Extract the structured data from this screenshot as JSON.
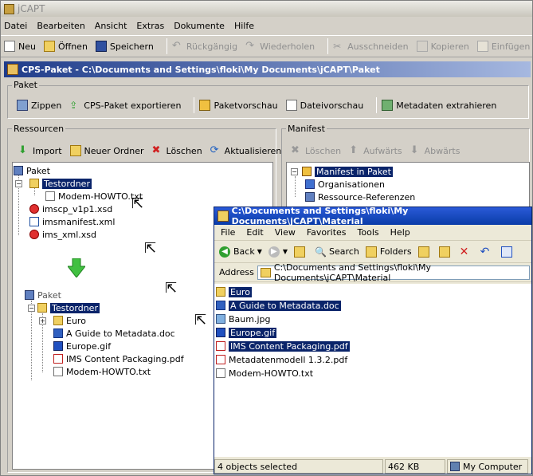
{
  "app": {
    "title": "jCAPT"
  },
  "menu": [
    "Datei",
    "Bearbeiten",
    "Ansicht",
    "Extras",
    "Dokumente",
    "Hilfe"
  ],
  "toolbar": {
    "neu": "Neu",
    "oeffnen": "Öffnen",
    "speichern": "Speichern",
    "rueckgaengig": "Rückgängig",
    "wiederholen": "Wiederholen",
    "ausschneiden": "Ausschneiden",
    "kopieren": "Kopieren",
    "einfuegen": "Einfügen"
  },
  "path": "CPS-Paket - C:\\Documents and Settings\\floki\\My Documents\\jCAPT\\Paket",
  "paket": {
    "label": "Paket",
    "buttons": [
      "Zippen",
      "CPS-Paket exportieren",
      "Paketvorschau",
      "Dateivorschau",
      "Metadaten extrahieren"
    ]
  },
  "ressourcen": {
    "label": "Ressourcen",
    "buttons": [
      "Import",
      "Neuer Ordner",
      "Löschen",
      "Aktualisieren"
    ],
    "tree_top": {
      "root": "Paket",
      "folder": "Testordner",
      "child": "Modem-HOWTO.txt",
      "files": [
        "imscp_v1p1.xsd",
        "imsmanifest.xml",
        "ims_xml.xsd"
      ]
    },
    "tree_bottom": {
      "root": "Paket",
      "folder": "Testordner",
      "children": [
        "Euro",
        "A Guide to Metadata.doc",
        "Europe.gif",
        "IMS Content Packaging.pdf",
        "Modem-HOWTO.txt"
      ]
    }
  },
  "manifest": {
    "label": "Manifest",
    "buttons": [
      "Löschen",
      "Aufwärts",
      "Abwärts"
    ],
    "tree": {
      "root": "Manifest in Paket",
      "children": [
        "Organisationen",
        "Ressource-Referenzen"
      ]
    }
  },
  "explorer": {
    "title": "C:\\Documents and Settings\\floki\\My Documents\\jCAPT\\Material",
    "menu": [
      "File",
      "Edit",
      "View",
      "Favorites",
      "Tools",
      "Help"
    ],
    "back": "Back",
    "search": "Search",
    "folders": "Folders",
    "address_label": "Address",
    "address_value": "C:\\Documents and Settings\\floki\\My Documents\\jCAPT\\Material",
    "items": [
      "Euro",
      "A Guide to Metadata.doc",
      "Baum.jpg",
      "Europe.gif",
      "IMS Content Packaging.pdf",
      "Metadatenmodell 1.3.2.pdf",
      "Modem-HOWTO.txt"
    ],
    "status": {
      "objects": "4 objects selected",
      "size": "462 KB",
      "location": "My Computer"
    }
  }
}
